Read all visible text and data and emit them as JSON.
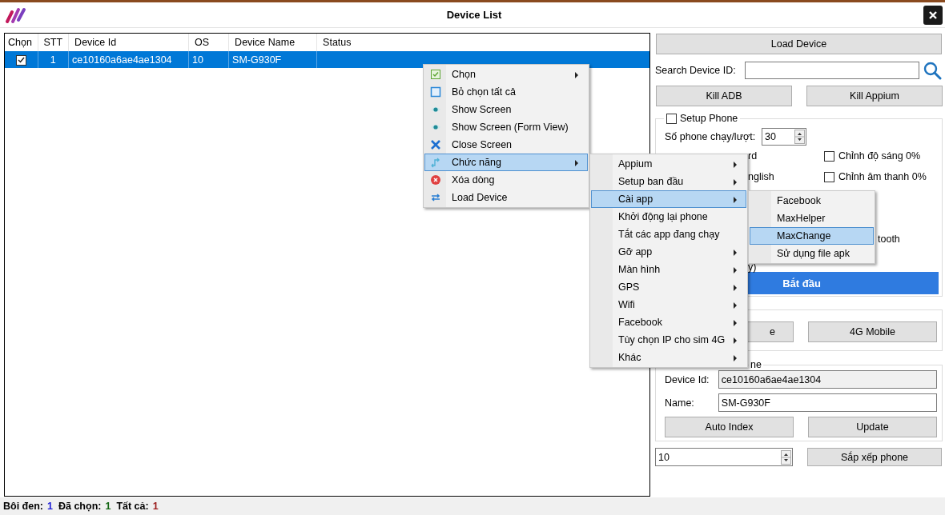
{
  "window": {
    "title": "Device List"
  },
  "table": {
    "check_column": "Chọn",
    "columns": [
      "STT",
      "Device Id",
      "OS",
      "Device Name",
      "Status"
    ],
    "rows": [
      {
        "selected": true,
        "checked": true,
        "cells": [
          "1",
          "ce10160a6ae4ae1304",
          "10",
          "SM-G930F"
        ]
      }
    ]
  },
  "panel": {
    "load_button": "Load Device",
    "search": {
      "label": "Search Device ID:"
    },
    "kill_buttons": [
      "Kill ADB",
      "Kill Appium"
    ],
    "setup": {
      "label": "Setup Phone",
      "checked": false,
      "count_label": "Số phone chạy/lượt:",
      "count_value": "30",
      "rows": [
        {
          "left": "rd",
          "option": {
            "label": "Chỉnh độ sáng 0%",
            "checked": false
          }
        },
        {
          "left": "nglish",
          "option": {
            "label": "Chỉnh âm thanh 0%",
            "checked": false
          }
        },
        {},
        {},
        {
          "right_text": "tooth"
        },
        {
          "left": "y)"
        }
      ],
      "start_button": "Bắt đầu"
    },
    "network_buttons": [
      "e",
      "4G Mobile"
    ],
    "device": {
      "legend": "ne",
      "id_label": "Device Id:",
      "id_value": "ce10160a6ae4ae1304",
      "name_label": "Name:",
      "name_value": "SM-G930F",
      "buttons": [
        "Auto Index",
        "Update"
      ]
    },
    "arrange": {
      "value": "10",
      "button": "Sắp xếp phone"
    }
  },
  "status_bar": [
    {
      "label": "Bôi đen:",
      "value": "1",
      "color": "#1c1cd6"
    },
    {
      "label": "Đã chọn:",
      "value": "1",
      "color": "#106410"
    },
    {
      "label": "Tất cả:",
      "value": "1",
      "color": "#9a1a1a"
    }
  ],
  "menus": [
    {
      "items": [
        {
          "label": "Chọn",
          "kind": "check",
          "submenu": true,
          "selected": false
        },
        {
          "label": "Bỏ chọn tất cả",
          "kind": "square",
          "submenu": false,
          "selected": false
        },
        {
          "label": "Show Screen",
          "kind": "eye",
          "submenu": false,
          "selected": false
        },
        {
          "label": "Show Screen (Form View)",
          "kind": "eye",
          "submenu": false,
          "selected": false
        },
        {
          "label": "Close Screen",
          "kind": "close",
          "submenu": false,
          "selected": false
        },
        {
          "label": "Chức năng",
          "kind": "turn",
          "submenu": true,
          "selected": true
        },
        {
          "label": "Xóa dòng",
          "kind": "delete",
          "submenu": false,
          "selected": false
        },
        {
          "label": "Load Device",
          "kind": "refresh",
          "submenu": false,
          "selected": false
        }
      ]
    },
    {
      "items": [
        {
          "label": "Appium",
          "submenu": true,
          "selected": false
        },
        {
          "label": "Setup ban đầu",
          "submenu": true,
          "selected": false
        },
        {
          "label": "Cài app",
          "submenu": true,
          "selected": true
        },
        {
          "label": "Khởi động lại phone",
          "submenu": false,
          "selected": false
        },
        {
          "label": "Tắt các app đang chạy",
          "submenu": false,
          "selected": false
        },
        {
          "label": "Gỡ app",
          "submenu": true,
          "selected": false
        },
        {
          "label": "Màn hình",
          "submenu": true,
          "selected": false
        },
        {
          "label": "GPS",
          "submenu": true,
          "selected": false
        },
        {
          "label": "Wifi",
          "submenu": true,
          "selected": false
        },
        {
          "label": "Facebook",
          "submenu": true,
          "selected": false
        },
        {
          "label": "Tùy chọn IP cho sim 4G",
          "submenu": true,
          "selected": false
        },
        {
          "label": "Khác",
          "submenu": true,
          "selected": false
        }
      ]
    },
    {
      "items": [
        {
          "label": "Facebook",
          "submenu": false,
          "selected": false
        },
        {
          "label": "MaxHelper",
          "submenu": false,
          "selected": false
        },
        {
          "label": "MaxChange",
          "submenu": false,
          "selected": true
        },
        {
          "label": "Sử dụng file apk",
          "submenu": false,
          "selected": false
        }
      ]
    }
  ]
}
